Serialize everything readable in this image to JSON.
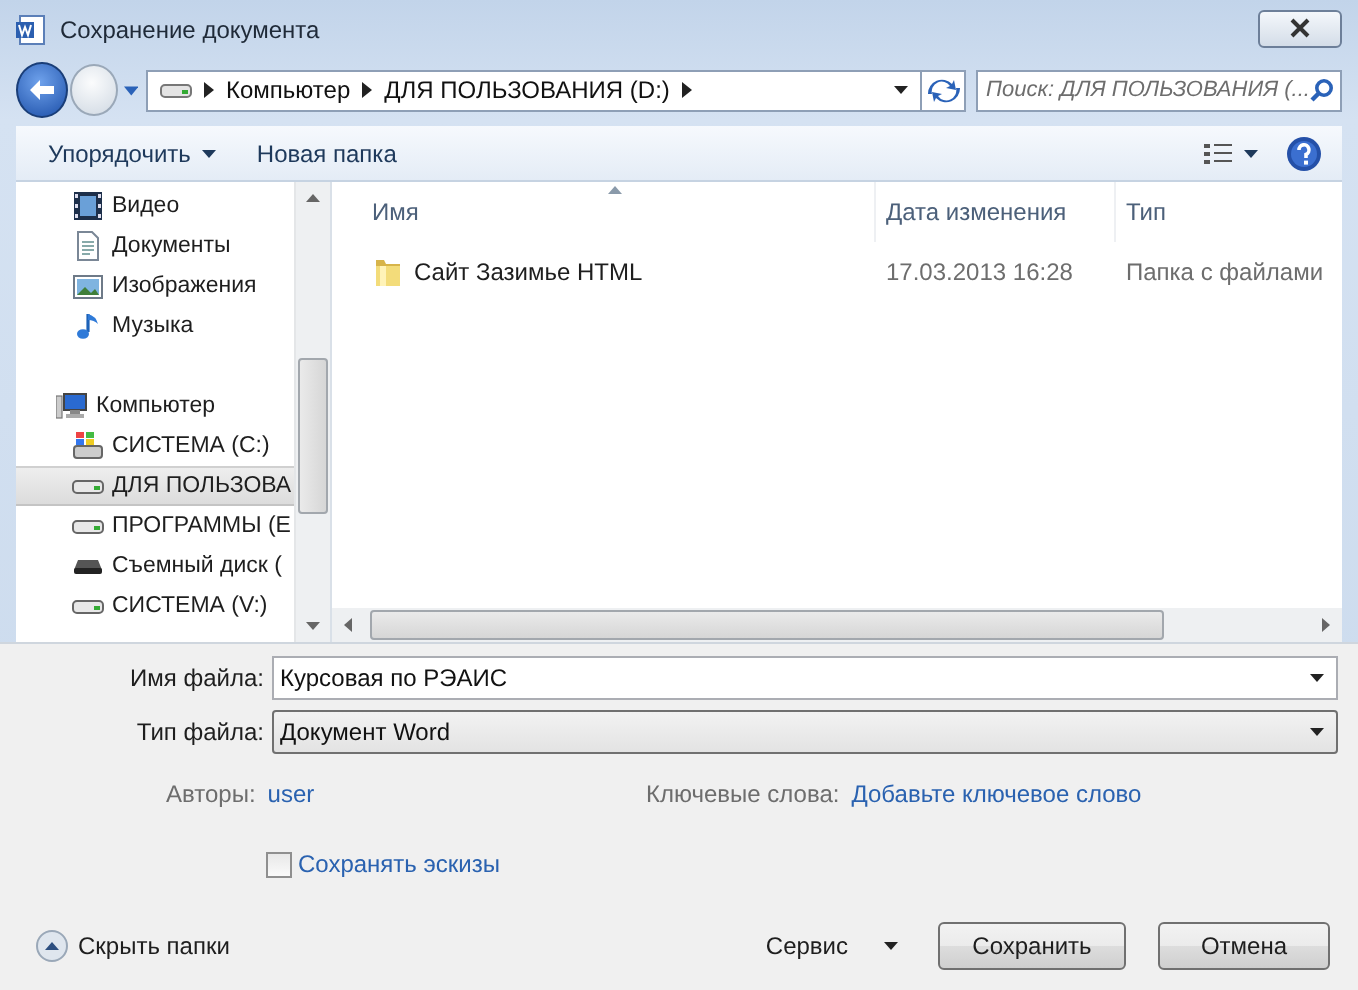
{
  "window": {
    "title": "Сохранение документа"
  },
  "navigation": {
    "breadcrumbs": [
      "Компьютер",
      "ДЛЯ ПОЛЬЗОВАНИЯ (D:)"
    ],
    "search": {
      "placeholder": "Поиск: ДЛЯ ПОЛЬЗОВАНИЯ (..."
    }
  },
  "toolbar": {
    "items": [
      {
        "label": "Упорядочить",
        "kind": "menu"
      },
      {
        "label": "Новая папка",
        "kind": "button"
      }
    ]
  },
  "sidebar": {
    "sections": [
      {
        "items": [
          {
            "label": "Видео",
            "kind": "video",
            "selected": false
          },
          {
            "label": "Документы",
            "kind": "documents",
            "selected": false
          },
          {
            "label": "Изображения",
            "kind": "images",
            "selected": false
          },
          {
            "label": "Музыка",
            "kind": "music",
            "selected": false
          }
        ]
      },
      {
        "label": "Компьютер",
        "kind": "computer",
        "items": [
          {
            "label": "СИСТЕМА (C:)",
            "kind": "system-drive",
            "selected": false
          },
          {
            "label": "ДЛЯ ПОЛЬЗОВА",
            "kind": "drive",
            "selected": true
          },
          {
            "label": "ПРОГРАММЫ (E",
            "kind": "drive",
            "selected": false
          },
          {
            "label": "Съемный диск (",
            "kind": "removable",
            "selected": false
          },
          {
            "label": "СИСТЕМА (V:)",
            "kind": "drive",
            "selected": false
          }
        ]
      }
    ]
  },
  "file_list": {
    "columns": [
      "Имя",
      "Дата изменения",
      "Тип"
    ],
    "rows": [
      {
        "name": "Сайт Зазимье HTML",
        "modified": "17.03.2013 16:28",
        "type": "Папка с файлами"
      }
    ]
  },
  "form": {
    "fields": [
      {
        "label": "Имя файла:",
        "value": "Курсовая по РЭАИС",
        "kind": "combo"
      },
      {
        "label": "Тип файла:",
        "value": "Документ Word",
        "kind": "select"
      }
    ],
    "metadata": [
      {
        "label": "Авторы:",
        "value": "user"
      },
      {
        "label": "Ключевые слова:",
        "value": "Добавьте ключевое слово"
      }
    ],
    "thumbnail_checkbox": {
      "label": "Сохранять эскизы",
      "checked": false
    }
  },
  "footer": {
    "hide_folders": "Скрыть папки",
    "tools": "Сервис",
    "buttons": [
      "Сохранить",
      "Отмена"
    ]
  }
}
